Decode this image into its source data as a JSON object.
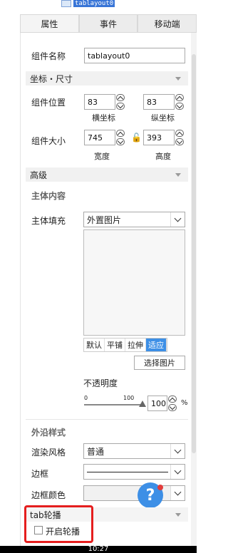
{
  "tree": {
    "node_label": "tablayout0"
  },
  "tabs": [
    {
      "label": "属性"
    },
    {
      "label": "事件"
    },
    {
      "label": "移动端"
    }
  ],
  "component_name": {
    "label": "组件名称",
    "value": "tablayout0"
  },
  "coord_section": {
    "title": "坐标・尺寸"
  },
  "position": {
    "label": "组件位置",
    "x": "83",
    "y": "83",
    "x_caption": "横坐标",
    "y_caption": "纵坐标"
  },
  "size": {
    "label": "组件大小",
    "w": "745",
    "h": "393",
    "w_caption": "宽度",
    "h_caption": "高度"
  },
  "advanced_section": {
    "title": "高级"
  },
  "body_content": {
    "title": "主体内容",
    "fill_label": "主体填充",
    "fill_value": "外置图片",
    "fit_modes": [
      "默认",
      "平铺",
      "拉伸",
      "适应"
    ],
    "choose_image": "选择图片",
    "opacity_label": "不透明度",
    "opacity_min": "0",
    "opacity_max": "100",
    "opacity_value": "100",
    "opacity_unit": "%"
  },
  "outer_style": {
    "title": "外沿样式",
    "render_label": "渲染风格",
    "render_value": "普通",
    "border_label": "边框",
    "border_color_label": "边框颜色"
  },
  "tab_carousel": {
    "title": "tab轮播",
    "checkbox_label": "开启轮播"
  },
  "status_bar": {
    "time": "10:27"
  },
  "colors": {
    "accent": "#3d8fe6",
    "highlight": "#e51e1e"
  }
}
